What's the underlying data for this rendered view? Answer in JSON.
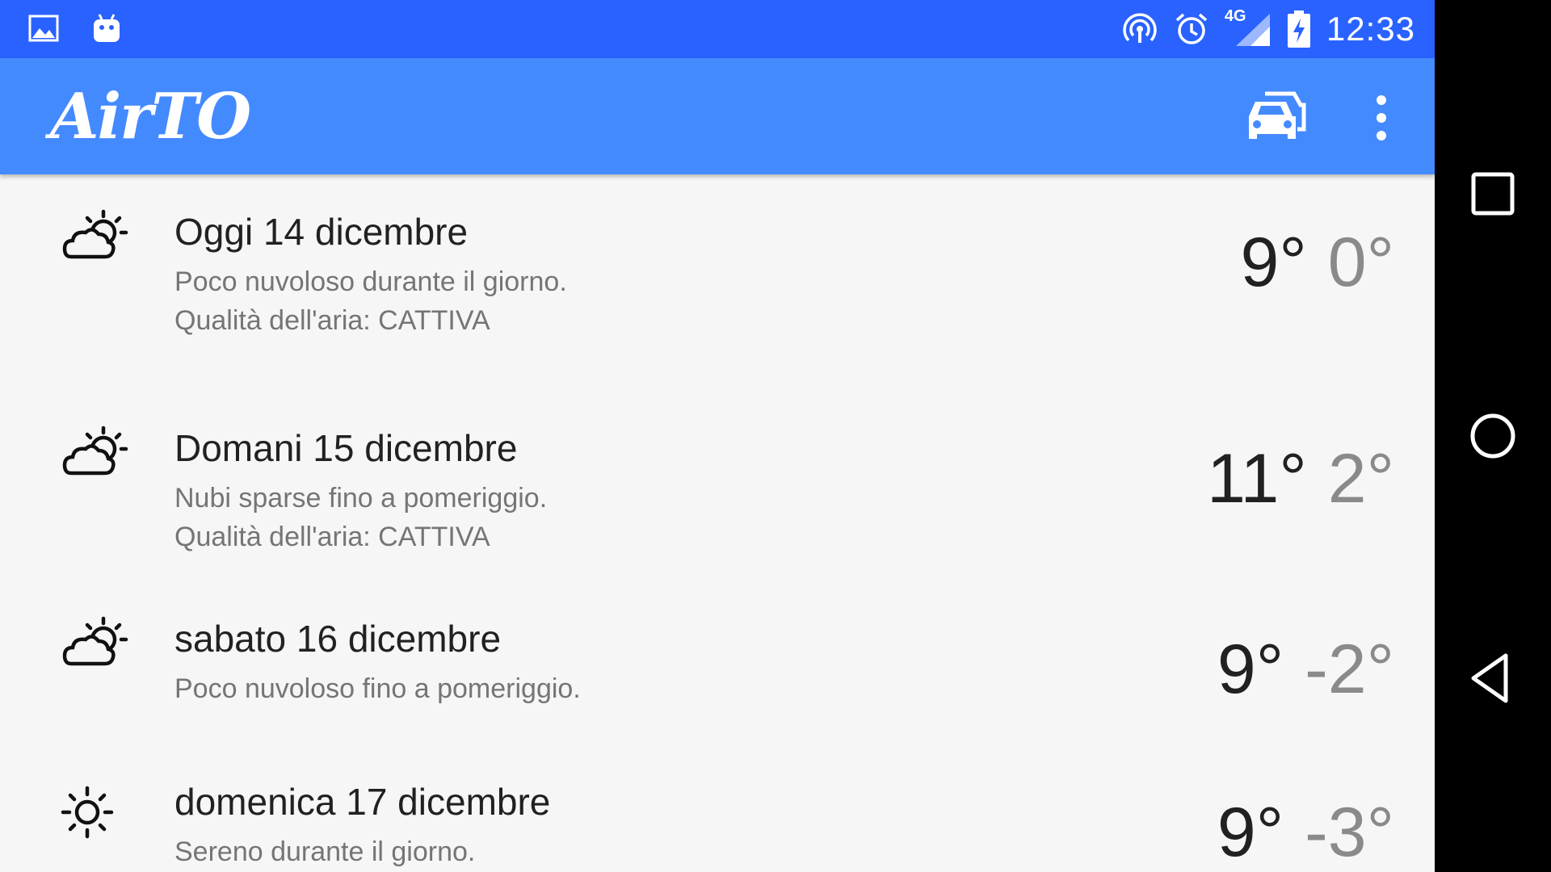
{
  "status_bar": {
    "time": "12:33",
    "left_icons": [
      "image-icon",
      "android-icon"
    ],
    "right_icons": [
      "hotspot-icon",
      "alarm-icon",
      "signal-4g-icon",
      "battery-charging-icon"
    ],
    "network_label": "4G"
  },
  "app_bar": {
    "title": "AirTO",
    "actions": [
      "car-traffic-icon",
      "overflow-menu-icon"
    ]
  },
  "forecast": [
    {
      "day": "Oggi 14 dicembre",
      "summary": "Poco nuvoloso durante il giorno.",
      "air_quality": "Qualità dell'aria: CATTIVA",
      "max": "9°",
      "min": "0°",
      "icon": "partly-cloudy-icon"
    },
    {
      "day": "Domani 15 dicembre",
      "summary": "Nubi sparse fino a pomeriggio.",
      "air_quality": "Qualità dell'aria: CATTIVA",
      "max": "11°",
      "min": "2°",
      "icon": "partly-cloudy-icon"
    },
    {
      "day": "sabato 16 dicembre",
      "summary": "Poco nuvoloso fino a pomeriggio.",
      "max": "9°",
      "min": "-2°",
      "icon": "partly-cloudy-icon"
    },
    {
      "day": "domenica 17 dicembre",
      "summary": "Sereno durante il giorno.",
      "max": "9°",
      "min": "-3°",
      "icon": "sun-icon"
    }
  ],
  "nav_bar": {
    "buttons": [
      "recents-button",
      "home-button",
      "back-button"
    ]
  },
  "colors": {
    "status_bar": "#2962ff",
    "app_bar": "#448aff",
    "background": "#f6f6f6",
    "primary_text": "#212121",
    "secondary_text": "#757575"
  }
}
